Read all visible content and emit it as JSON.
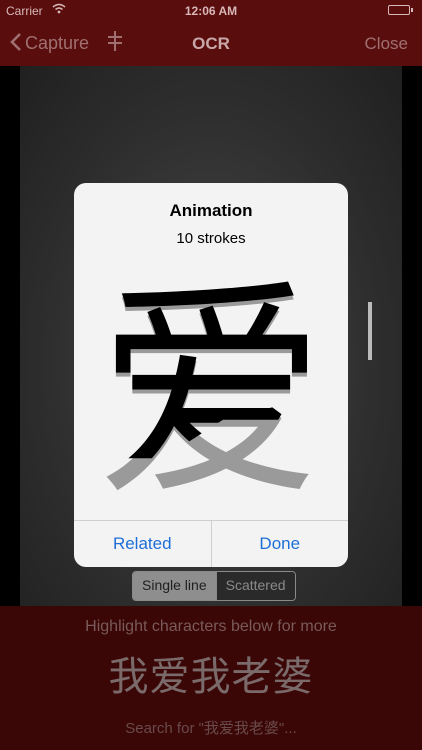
{
  "status_bar": {
    "carrier": "Carrier",
    "time": "12:06 AM",
    "wifi_icon": "wifi-icon",
    "battery_icon": "battery-icon"
  },
  "nav": {
    "back_label": "Capture",
    "back_icon": "chevron-left-icon",
    "tuning_icon": "tuning-icon",
    "title": "OCR",
    "close_label": "Close"
  },
  "capture": {
    "segments": [
      "Single line",
      "Scattered"
    ],
    "selected_segment": "Single line"
  },
  "bottom": {
    "hint": "Highlight characters below for more",
    "characters": "我爱我老婆",
    "search_link": "Search for \"我爱我老婆\"..."
  },
  "alert": {
    "title": "Animation",
    "subtitle": "10 strokes",
    "character": "爱",
    "buttons": [
      "Related",
      "Done"
    ]
  },
  "colors": {
    "nav_background": "#5a0d0d",
    "panel_background": "#3a0606",
    "alert_button": "#1d6fd8"
  }
}
